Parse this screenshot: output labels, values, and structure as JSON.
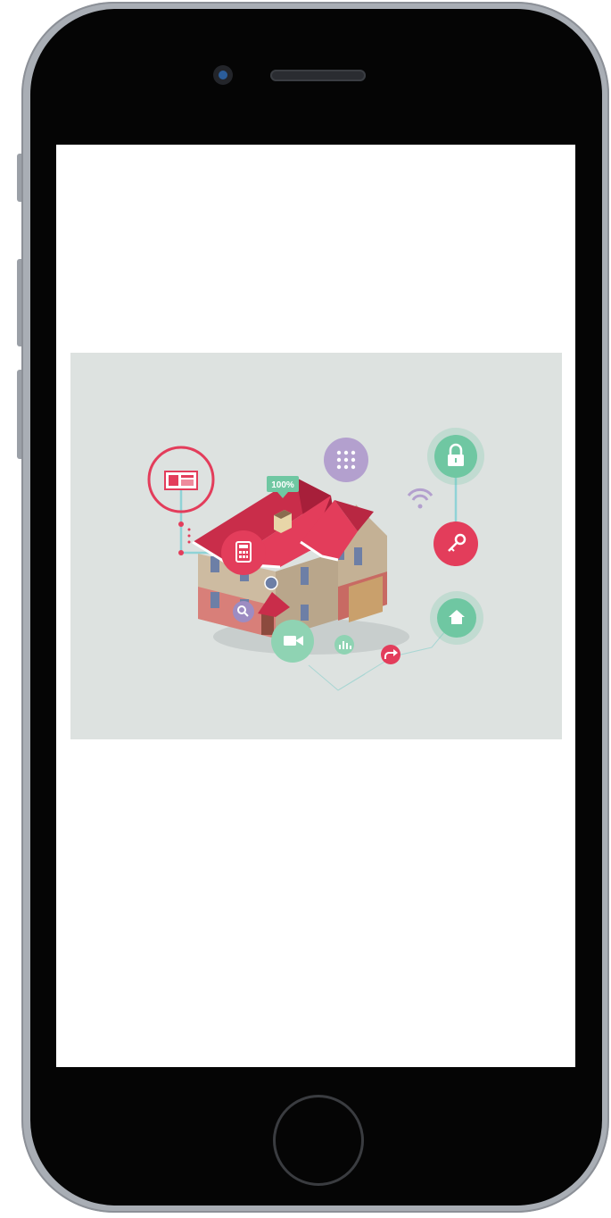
{
  "device": {
    "frame_color": "#a9aeb5",
    "body_color": "#050505",
    "screen_color": "#ffffff"
  },
  "status_bar": {
    "carrier": "",
    "time": ""
  },
  "hero_image": {
    "background_color": "#dde2e0",
    "badge_text": "100%",
    "accent_colors": {
      "red": "#e33d5b",
      "green": "#6fc7a2",
      "purple": "#b3a0ce",
      "wall": "#cdbba1",
      "brick": "#d87f79"
    },
    "icons": [
      "tablet-control-icon",
      "calculator-icon",
      "search-icon",
      "keypad-icon",
      "wifi-icon",
      "lock-icon",
      "key-icon",
      "home-icon",
      "video-camera-icon",
      "bar-chart-icon",
      "share-arrow-icon"
    ]
  }
}
